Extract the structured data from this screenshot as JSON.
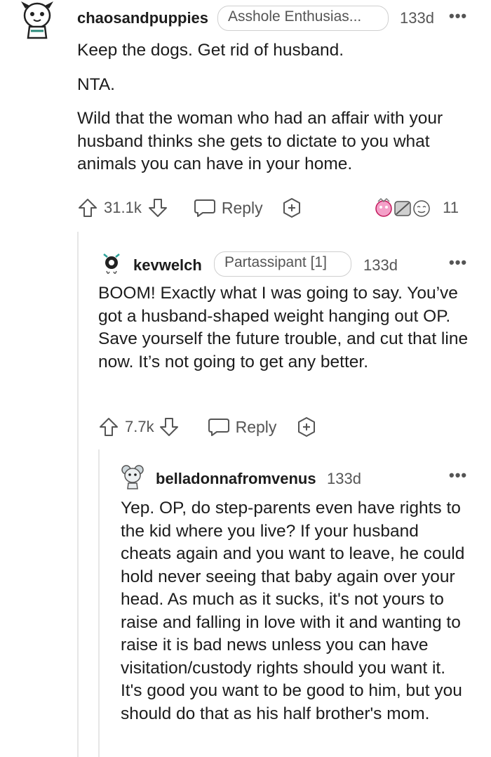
{
  "comments": [
    {
      "username": "chaosandpuppies",
      "flair": "Asshole Enthusias...",
      "age": "133d",
      "more": "•••",
      "paragraphs": [
        "Keep the dogs. Get rid of husband.",
        "NTA.",
        "Wild that the woman who had an affair with your husband thinks she gets to dictate to you what animals you can have in your home."
      ],
      "votes": "31.1k",
      "reply_label": "Reply",
      "awards_count": "11"
    },
    {
      "username": "kevwelch",
      "flair": "Partassipant [1]",
      "age": "133d",
      "more": "•••",
      "paragraphs": [
        "BOOM! Exactly what I was going to say. You’ve got a husband-shaped weight hanging out OP. Save yourself the future trouble, and cut that line now. It’s not going to get any better."
      ],
      "votes": "7.7k",
      "reply_label": "Reply"
    },
    {
      "username": "belladonnafromvenus",
      "age": "133d",
      "more": "•••",
      "paragraphs": [
        "Yep. OP, do step-parents even have rights to the kid where you live? If your husband cheats again and you want to leave, he could hold never seeing that baby again over your head. As much as it sucks, it's not yours to raise and falling in love with it and wanting to raise it is bad news unless you can have visitation/custody rights should you want it. It's good you want to be good to him, but you should do that as his half brother's mom."
      ]
    }
  ]
}
